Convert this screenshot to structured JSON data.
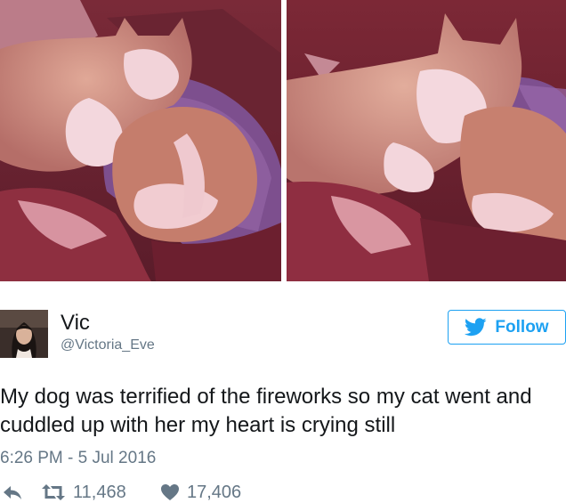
{
  "photos": {
    "left_photo_icon": "cat-and-dog-photo",
    "right_photo_icon": "cat-and-dog-photo"
  },
  "user": {
    "display_name": "Vic",
    "handle": "@Victoria_Eve",
    "avatar_icon": "profile-photo"
  },
  "follow": {
    "label": "Follow",
    "icon": "twitter-bird-icon",
    "color": "#1da1f2"
  },
  "tweet": {
    "text": "My dog was terrified of the fireworks so my cat went and cuddled up with her my heart is crying still",
    "timestamp": "6:26 PM - 5 Jul 2016"
  },
  "actions": {
    "reply_icon": "reply-icon",
    "retweet_icon": "retweet-icon",
    "retweet_count": "11,468",
    "like_icon": "heart-icon",
    "like_count": "17,406"
  },
  "colors": {
    "text": "#14171a",
    "secondary_text": "#657786",
    "accent": "#1da1f2"
  }
}
